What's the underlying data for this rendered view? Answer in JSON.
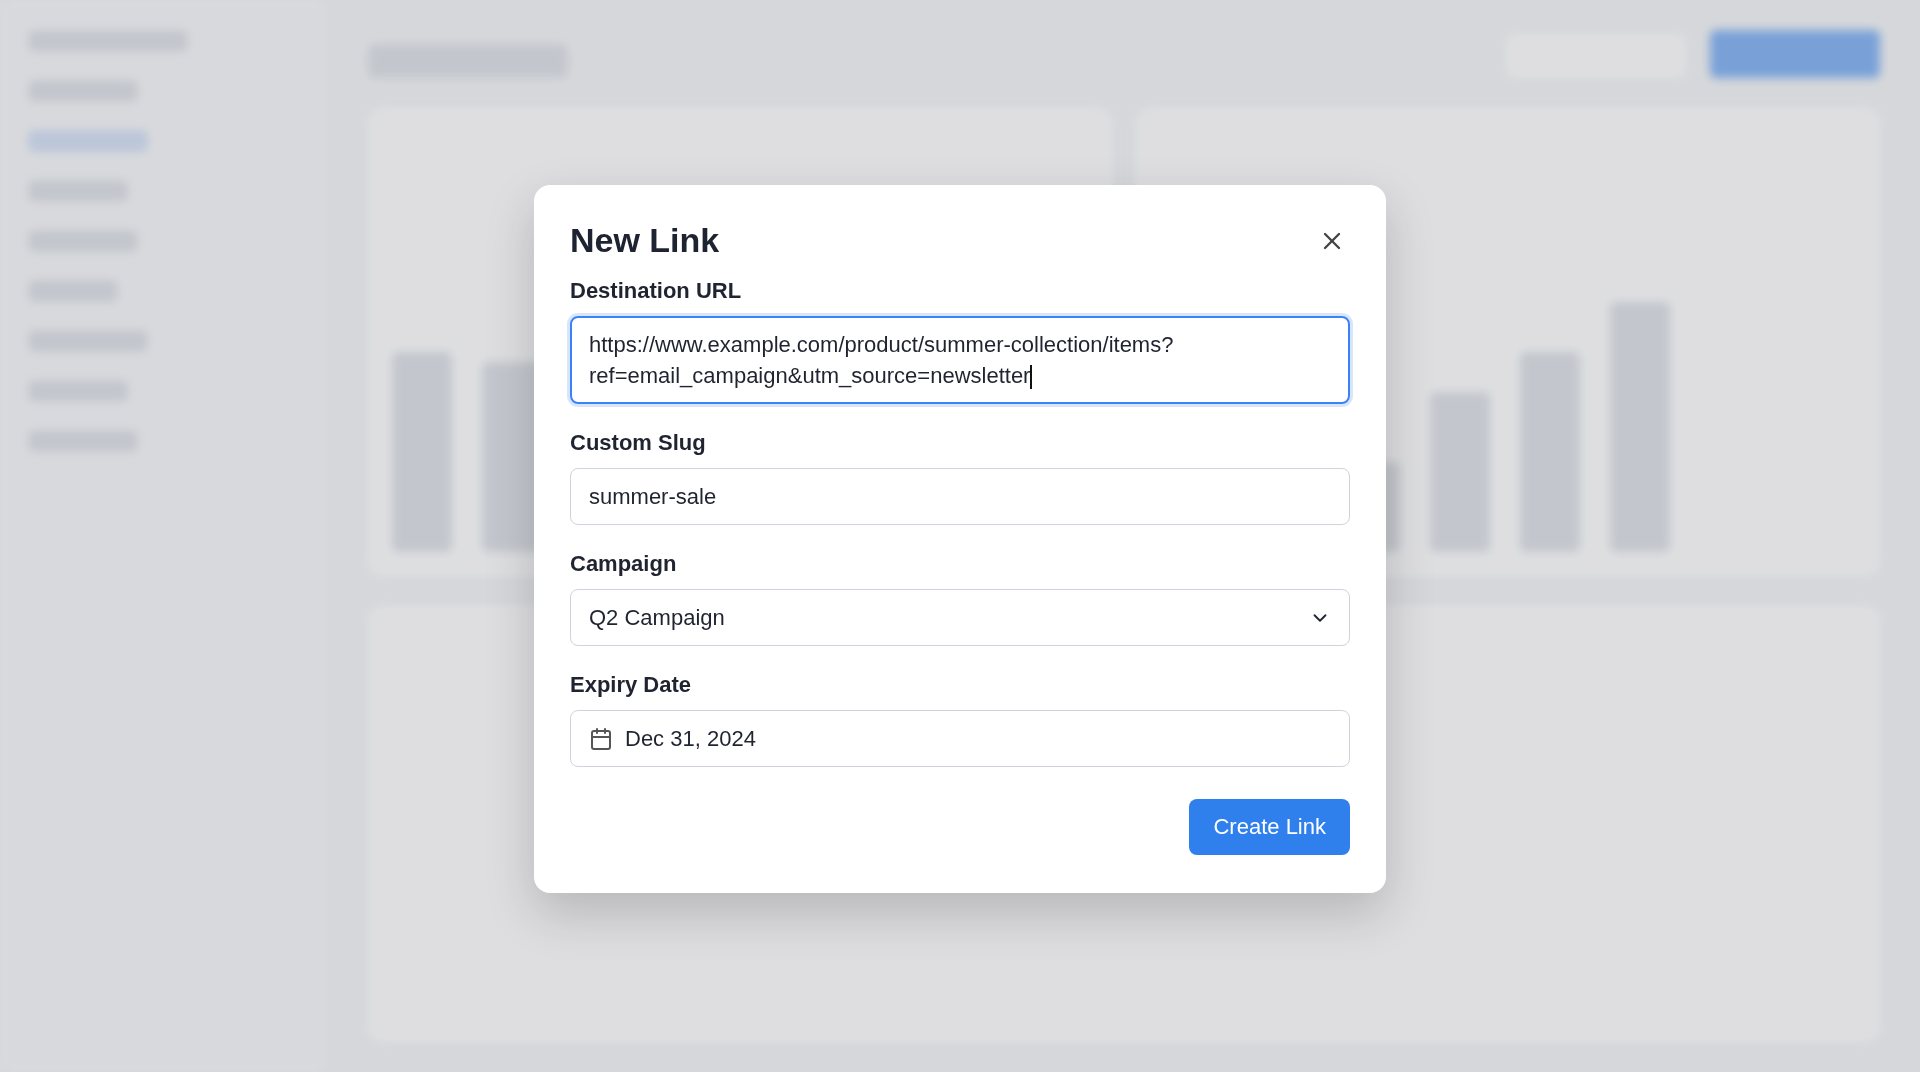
{
  "dialog": {
    "title": "New Link",
    "fields": [
      {
        "kind": "textarea",
        "label": "Destination URL",
        "value": "https://www.example.com/product/summer-collection/items?ref=email_campaign&utm_source=newsletter",
        "focused": true
      },
      {
        "kind": "text",
        "label": "Custom Slug",
        "value": "summer-sale",
        "focused": false
      },
      {
        "kind": "select",
        "label": "Campaign",
        "value": "Q2 Campaign",
        "focused": false
      },
      {
        "kind": "date",
        "label": "Expiry Date",
        "value": "Dec 31, 2024",
        "focused": false
      }
    ],
    "primary_button": "Create Link"
  }
}
